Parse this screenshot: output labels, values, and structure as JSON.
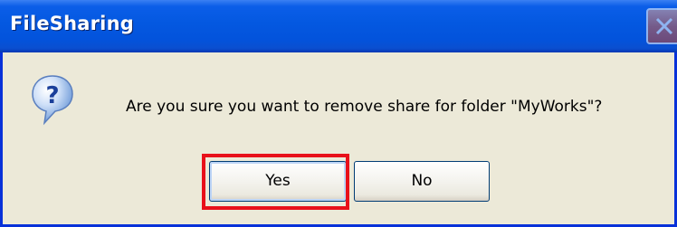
{
  "window": {
    "title": "FileSharing"
  },
  "dialog": {
    "icon": "question-icon",
    "message": "Are you sure you want to remove share for folder \"MyWorks\"?",
    "buttons": {
      "yes_label": "Yes",
      "no_label": "No"
    },
    "highlighted_button": "Yes"
  },
  "colors": {
    "titlebar": "#0458e0",
    "highlight": "#e8101a",
    "background": "#ece9d8"
  }
}
